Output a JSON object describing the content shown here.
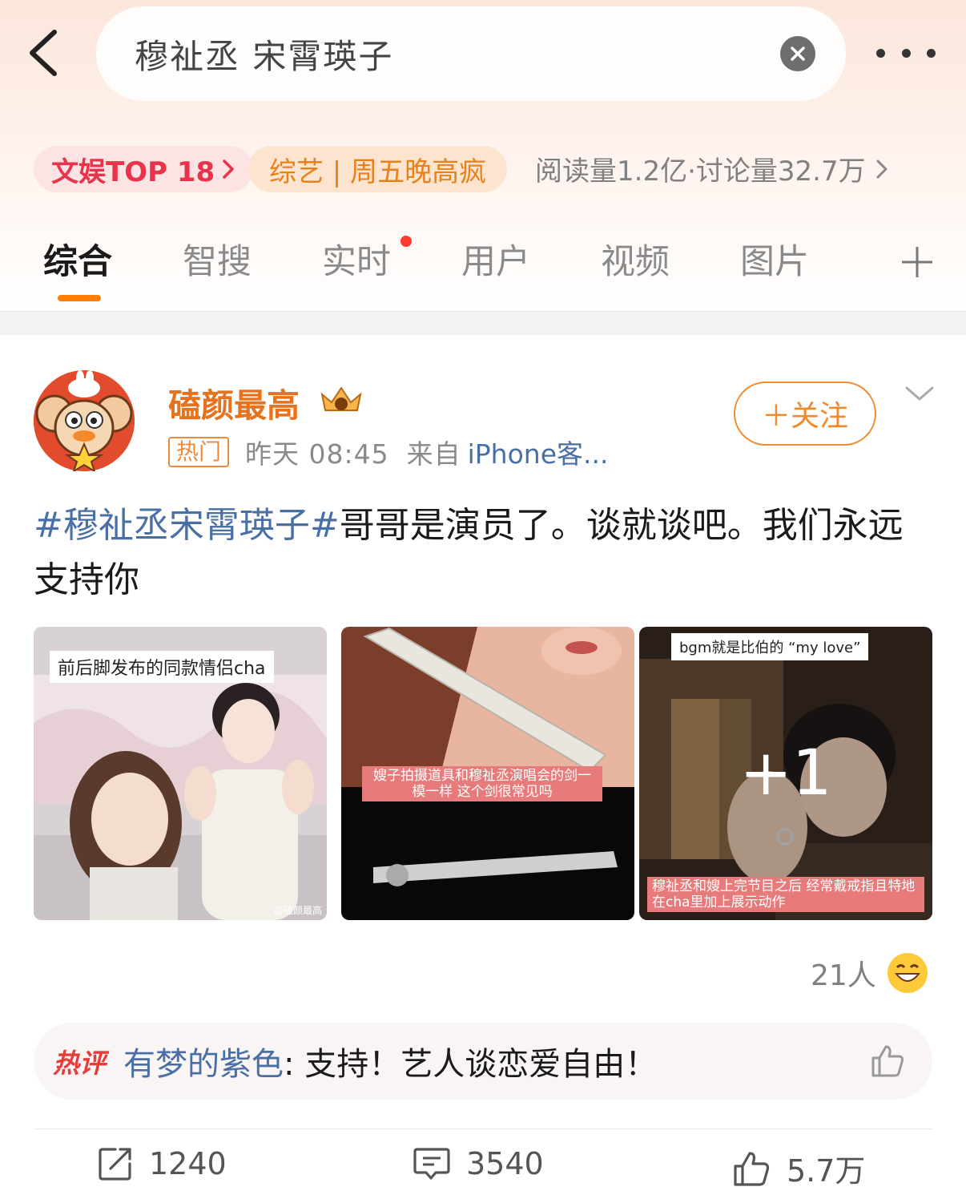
{
  "search": {
    "query": "穆祉丞 宋霄瑛子"
  },
  "topic": {
    "rank_chip": "文娱TOP 18",
    "category_chip": "综艺 | 周五晚高疯",
    "stats": "阅读量1.2亿·讨论量32.7万"
  },
  "tabs": [
    "综合",
    "智搜",
    "实时",
    "用户",
    "视频",
    "图片"
  ],
  "post": {
    "author": "磕颜最高",
    "tag": "热门",
    "time": "昨天 08:45",
    "from": "来自",
    "source": "iPhone客...",
    "follow": "＋关注",
    "hashtag": "#穆祉丞宋霄瑛子#",
    "body": "哥哥是演员了。谈就谈吧。我们永远支持你",
    "images": [
      {
        "caption": "前后脚发布的同款情侣cha",
        "watermark": "@磕颜最高"
      },
      {
        "caption": "嫂子拍摄道具和穆祉丞演唱会的剑一模一样 这个剑很常见吗"
      },
      {
        "caption_top": "bgm就是比伯的 “my love”",
        "caption_bottom": "穆祉丞和嫂上完节目之后 经常戴戒指且特地在cha里加上展示动作",
        "more": "+1"
      }
    ],
    "reaction_count": "21人",
    "hot_comment": {
      "label": "热评",
      "user": "有梦的紫色",
      "text": ": 支持！艺人谈恋爱自由！"
    },
    "actions": {
      "repost": "1240",
      "comment": "3540",
      "like": "5.7万"
    }
  }
}
